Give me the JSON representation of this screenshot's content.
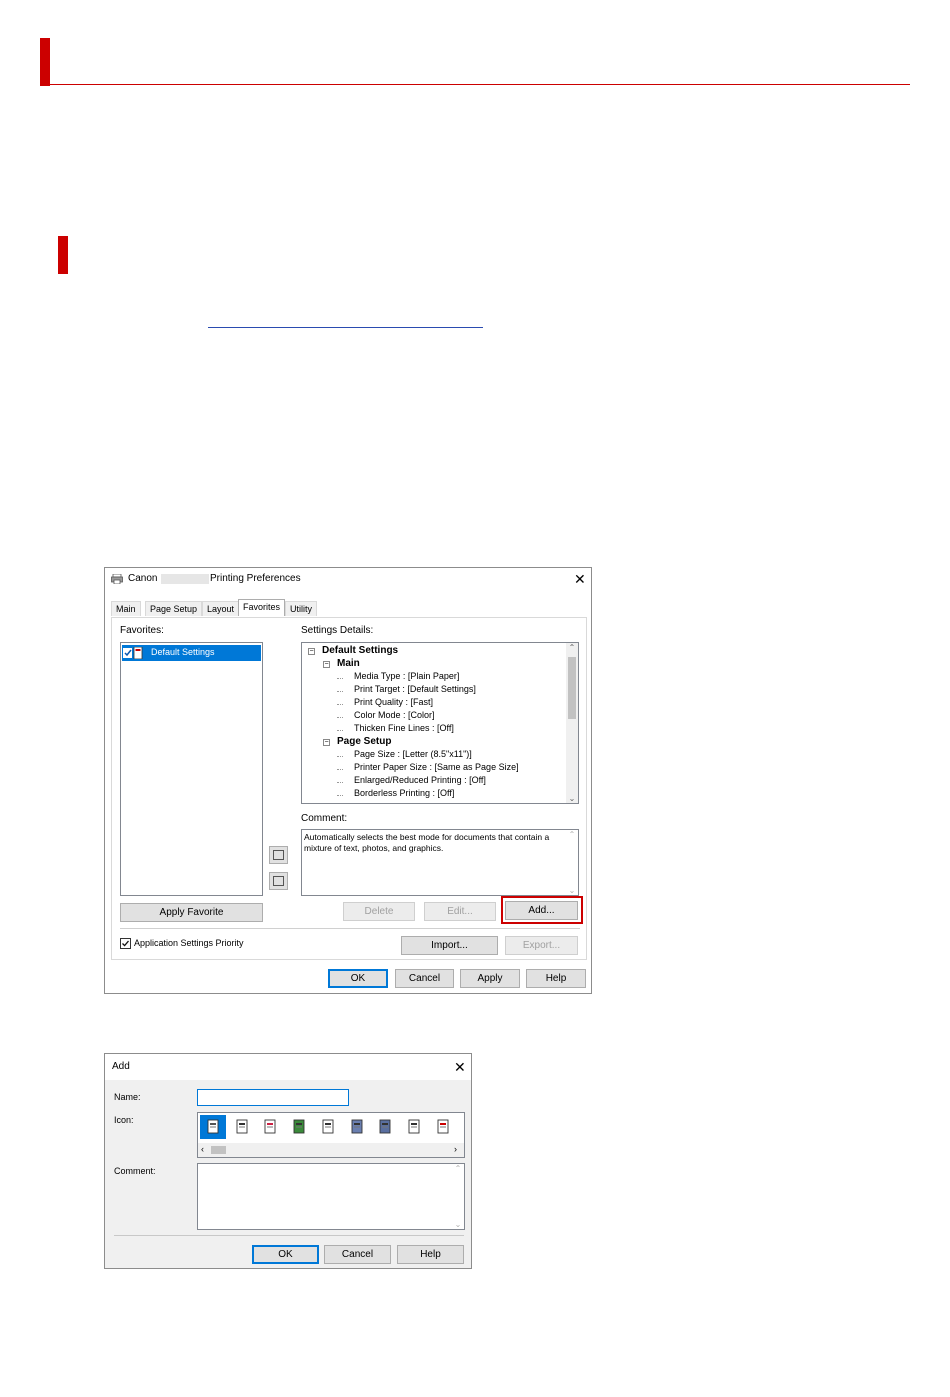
{
  "printing_prefs": {
    "title_prefix": "Canon",
    "title_suffix": "Printing Preferences",
    "tabs": [
      "Main",
      "Page Setup",
      "Layout",
      "Favorites",
      "Utility"
    ],
    "active_tab": "Favorites",
    "favorites_label": "Favorites:",
    "favorites_items": [
      "Default Settings"
    ],
    "settings_details_label": "Settings Details:",
    "tree": [
      {
        "text": "Default Settings",
        "level": 0,
        "bold": true
      },
      {
        "text": "Main",
        "level": 1,
        "bold": true
      },
      {
        "text": "Media Type : [Plain Paper]",
        "level": 2
      },
      {
        "text": "Print Target : [Default Settings]",
        "level": 2
      },
      {
        "text": "Print Quality : [Fast]",
        "level": 2
      },
      {
        "text": "Color Mode : [Color]",
        "level": 2
      },
      {
        "text": "Thicken Fine Lines : [Off]",
        "level": 2
      },
      {
        "text": "Page Setup",
        "level": 1,
        "bold": true
      },
      {
        "text": "Page Size : [Letter (8.5\"x11\")]",
        "level": 2
      },
      {
        "text": "Printer Paper Size : [Same as Page Size]",
        "level": 2
      },
      {
        "text": "Enlarged/Reduced Printing : [Off]",
        "level": 2
      },
      {
        "text": "Borderless Printing : [Off]",
        "level": 2
      }
    ],
    "comment_label": "Comment:",
    "comment_text": "Automatically selects the best mode for documents that contain a mixture of text, photos, and graphics.",
    "buttons": {
      "apply_favorite": "Apply Favorite",
      "delete": "Delete",
      "edit": "Edit...",
      "add": "Add...",
      "import": "Import...",
      "export": "Export...",
      "ok": "OK",
      "cancel": "Cancel",
      "apply": "Apply",
      "help": "Help"
    },
    "app_settings_priority": "Application Settings Priority",
    "app_settings_priority_checked": true,
    "highlight_color": "#cc0000"
  },
  "add_dialog": {
    "title": "Add",
    "name_label": "Name:",
    "name_value": "",
    "icon_label": "Icon:",
    "comment_label": "Comment:",
    "icon_count": 9,
    "selected_icon_index": 0,
    "buttons": {
      "ok": "OK",
      "cancel": "Cancel",
      "help": "Help"
    }
  },
  "colors": {
    "accent_red": "#cc0000",
    "selection_blue": "#0078d7"
  }
}
